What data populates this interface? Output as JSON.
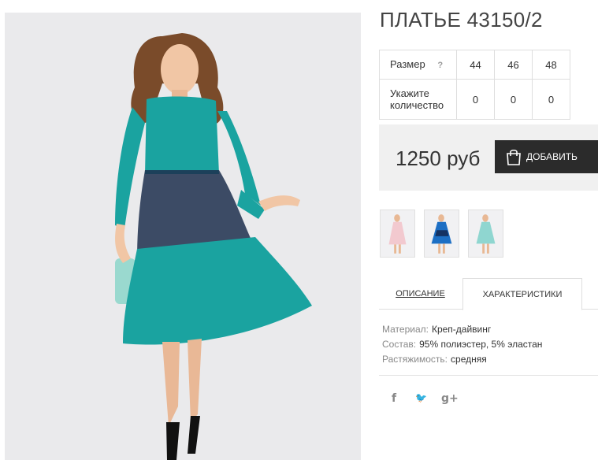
{
  "product": {
    "title": "ПЛАТЬЕ 43150/2",
    "price": "1250 руб",
    "add_to_cart_label": "ДОБАВИТЬ"
  },
  "size_table": {
    "size_label": "Размер",
    "help_icon": "?",
    "sizes": [
      "44",
      "46",
      "48"
    ],
    "quantity_label": "Укажите количество",
    "quantities": [
      "0",
      "0",
      "0"
    ]
  },
  "tabs": {
    "description": "ОПИСАНИЕ",
    "characteristics": "ХАРАКТЕРИСТИКИ"
  },
  "characteristics": [
    {
      "key": "Материал:",
      "value": "Креп-дайвинг"
    },
    {
      "key": "Состав:",
      "value": "95% полиэстер, 5% эластан"
    },
    {
      "key": "Растяжимость:",
      "value": "средняя"
    }
  ],
  "social": {
    "facebook": "f",
    "twitter": "🐦",
    "googleplus": "g+"
  },
  "colors": {
    "dress_main": "#1aa3a0",
    "tulle": "#1d2f4d",
    "button_bg": "#2b2b2b",
    "thumb_pink": "#f2c9cf",
    "thumb_blue": "#1d6fc4",
    "thumb_mint": "#8fd6d0"
  },
  "icons": {
    "bag": "shopping-bag-icon",
    "help": "question-icon"
  }
}
